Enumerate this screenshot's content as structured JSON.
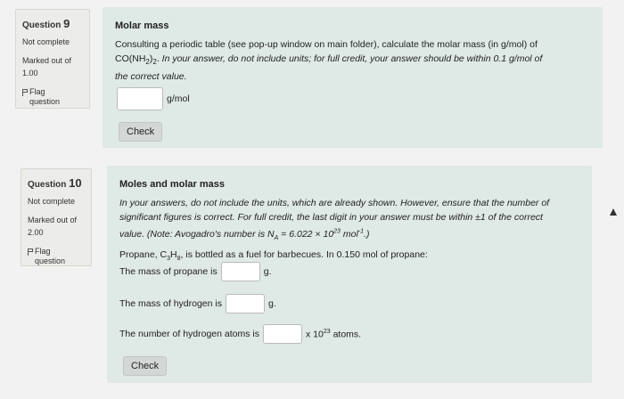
{
  "q9": {
    "label": "Question",
    "num": "9",
    "status": "Not complete",
    "marked": "Marked out of",
    "score": "1.00",
    "flag1": "Flag",
    "flag2": "question",
    "title": "Molar mass",
    "line1": "Consulting a periodic table (see pop-up window on main folder), calculate the molar mass (in g/mol) of",
    "formula_pre": "CO(NH",
    "formula_sub": "2",
    "formula_post": ")",
    "formula_sub2": "2",
    "formula_dot": ".",
    "line2_italic": " In your answer, do not include units; for full credit, your answer should be within 0.1 g/mol of",
    "line3": "the correct value.",
    "unit": "g/mol",
    "check": "Check"
  },
  "q10": {
    "label": "Question",
    "num": "10",
    "status": "Not complete",
    "marked": "Marked out of",
    "score": "2.00",
    "flag1": "Flag",
    "flag2": "question",
    "title": "Moles and molar mass",
    "l1": "In your answers, do not include the units, which are already shown.  However, ensure that the number of",
    "l2": "significant figures is correct.  For full credit, the last digit in your answer must be within ±1 of the correct",
    "l3a": "value.  (Note: Avogadro's number is N",
    "l3sub": "A",
    "l3b": " = 6.022 × 10",
    "l3sup": "23",
    "l3c": " mol",
    "l3sup2": "-1",
    "l3d": ".)",
    "p1": "Propane, C",
    "p1sub1": "3",
    "p1b": "H",
    "p1sub2": "8",
    "p1c": ", is bottled as a fuel for barbecues.  In 0.150 mol of propane:",
    "mass_propane": "The mass of propane is",
    "mass_h": "The mass of hydrogen is",
    "num_h": "The number of hydrogen atoms is",
    "unit_g": "g.",
    "unit_x": "x 10",
    "unit_x_sup": "23",
    "unit_atoms": " atoms.",
    "check": "Check"
  }
}
